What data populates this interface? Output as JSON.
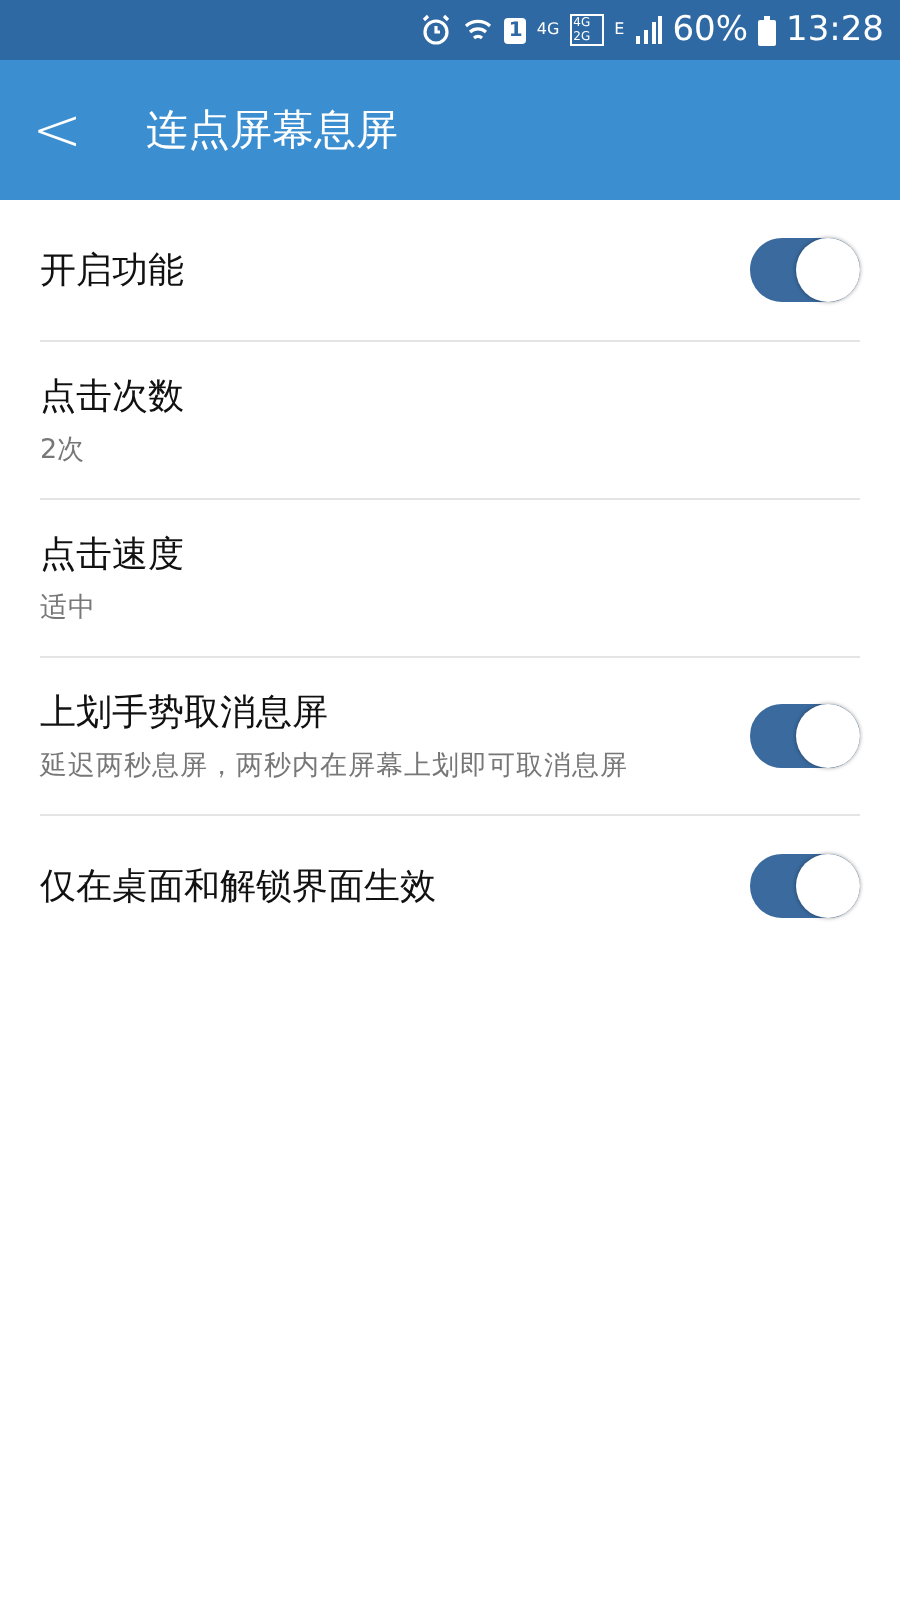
{
  "status_bar": {
    "sim_slot": "1",
    "network": "4G",
    "dual_network": [
      "4G",
      "2G"
    ],
    "data_type": "E",
    "battery": "60%",
    "time": "13:28"
  },
  "app_bar": {
    "back": "<",
    "title": "连点屏幕息屏"
  },
  "settings": [
    {
      "kind": "switch",
      "title": "开启功能",
      "on": true
    },
    {
      "kind": "value",
      "title": "点击次数",
      "subtitle": "2次"
    },
    {
      "kind": "value",
      "title": "点击速度",
      "subtitle": "适中"
    },
    {
      "kind": "switch",
      "title": "上划手势取消息屏",
      "subtitle": "延迟两秒息屏，两秒内在屏幕上划即可取消息屏",
      "on": true
    },
    {
      "kind": "switch",
      "title": "仅在桌面和解锁界面生效",
      "on": true
    }
  ]
}
